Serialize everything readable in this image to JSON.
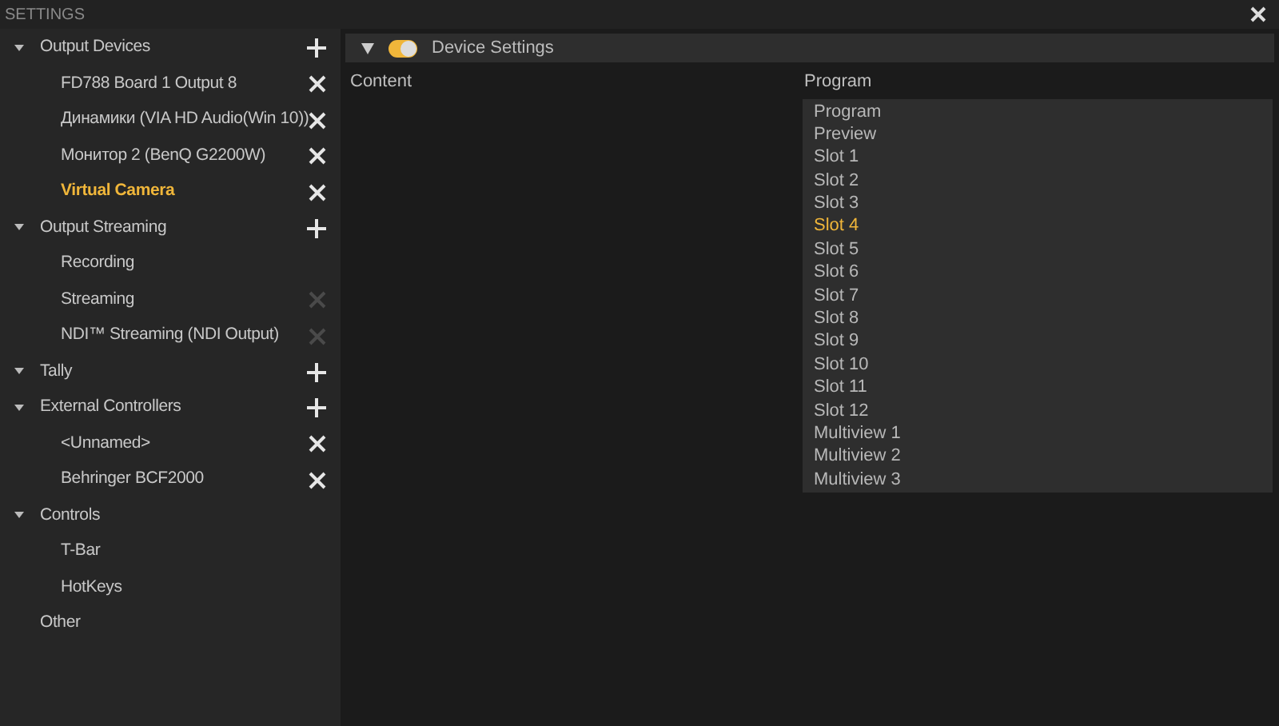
{
  "window": {
    "title": "SETTINGS"
  },
  "sidebar": {
    "items": [
      {
        "label": "Output Devices",
        "expanded": true,
        "kind": "add",
        "action_disabled": false,
        "selected": false,
        "children": [
          {
            "label": "FD788 Board 1 Output 8",
            "kind": "remove",
            "action_disabled": false,
            "selected": false
          },
          {
            "label": "Динамики (VIA HD Audio(Win 10))",
            "kind": "remove",
            "action_disabled": false,
            "selected": false
          },
          {
            "label": "Монитор 2 (BenQ G2200W)",
            "kind": "remove",
            "action_disabled": false,
            "selected": false
          },
          {
            "label": "Virtual Camera",
            "kind": "remove",
            "action_disabled": false,
            "selected": true
          }
        ]
      },
      {
        "label": "Output Streaming",
        "expanded": true,
        "kind": "add",
        "action_disabled": false,
        "selected": false,
        "children": [
          {
            "label": "Recording",
            "selected": false
          },
          {
            "label": "Streaming",
            "kind": "remove",
            "action_disabled": true,
            "selected": false
          },
          {
            "label": "NDI™ Streaming (NDI Output)",
            "kind": "remove",
            "action_disabled": true,
            "selected": false
          }
        ]
      },
      {
        "label": "Tally",
        "expanded": true,
        "kind": "add",
        "action_disabled": false,
        "selected": false
      },
      {
        "label": "External Controllers",
        "expanded": true,
        "kind": "add",
        "action_disabled": false,
        "selected": false,
        "children": [
          {
            "label": "<Unnamed>",
            "kind": "remove",
            "action_disabled": false,
            "selected": false
          },
          {
            "label": "Behringer BCF2000",
            "kind": "remove",
            "action_disabled": false,
            "selected": false
          }
        ]
      },
      {
        "label": "Controls",
        "expanded": true,
        "selected": false,
        "children": [
          {
            "label": "T-Bar",
            "selected": false
          },
          {
            "label": "HotKeys",
            "selected": false
          }
        ]
      },
      {
        "label": "Other",
        "selected": false
      }
    ]
  },
  "section": {
    "title": "Device Settings",
    "expanded": true,
    "on": true
  },
  "content": {
    "label": "Content",
    "value": "Program",
    "options": [
      {
        "label": "Program",
        "highlighted": false
      },
      {
        "label": "Preview",
        "highlighted": false
      },
      {
        "label": "Slot 1",
        "highlighted": false
      },
      {
        "label": "Slot 2",
        "highlighted": false
      },
      {
        "label": "Slot 3",
        "highlighted": false
      },
      {
        "label": "Slot 4",
        "highlighted": true
      },
      {
        "label": "Slot 5",
        "highlighted": false
      },
      {
        "label": "Slot 6",
        "highlighted": false
      },
      {
        "label": "Slot 7",
        "highlighted": false
      },
      {
        "label": "Slot 8",
        "highlighted": false
      },
      {
        "label": "Slot 9",
        "highlighted": false
      },
      {
        "label": "Slot 10",
        "highlighted": false
      },
      {
        "label": "Slot 11",
        "highlighted": false
      },
      {
        "label": "Slot 12",
        "highlighted": false
      },
      {
        "label": "Multiview 1",
        "highlighted": false
      },
      {
        "label": "Multiview 2",
        "highlighted": false
      },
      {
        "label": "Multiview 3",
        "highlighted": false
      }
    ]
  }
}
